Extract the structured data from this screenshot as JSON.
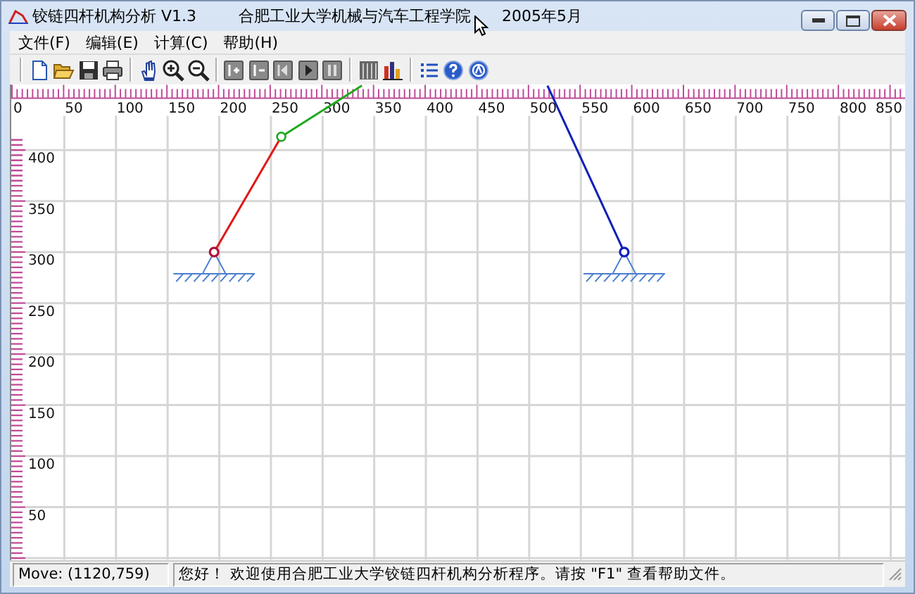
{
  "window": {
    "title": "铰链四杆机构分析 V1.3",
    "subtitle": "合肥工业大学机械与汽车工程学院",
    "date": "2005年5月"
  },
  "menu": [
    {
      "label": "文件(F)"
    },
    {
      "label": "编辑(E)"
    },
    {
      "label": "计算(C)"
    },
    {
      "label": "帮助(H)"
    }
  ],
  "canvas": {
    "x_ticks": [
      "0",
      "50",
      "100",
      "150",
      "200",
      "250",
      "300",
      "350",
      "400",
      "450",
      "500",
      "550",
      "600",
      "650",
      "700",
      "750",
      "800",
      "850"
    ],
    "y_ticks": [
      "400",
      "350",
      "300",
      "250",
      "200",
      "150",
      "100",
      "50"
    ]
  },
  "status_bar": {
    "position": "Move: (1120,759)",
    "message": "您好！ 欢迎使用合肥工业大学铰链四杆机构分析程序。请按 \"F1\" 查看帮助文件。"
  }
}
